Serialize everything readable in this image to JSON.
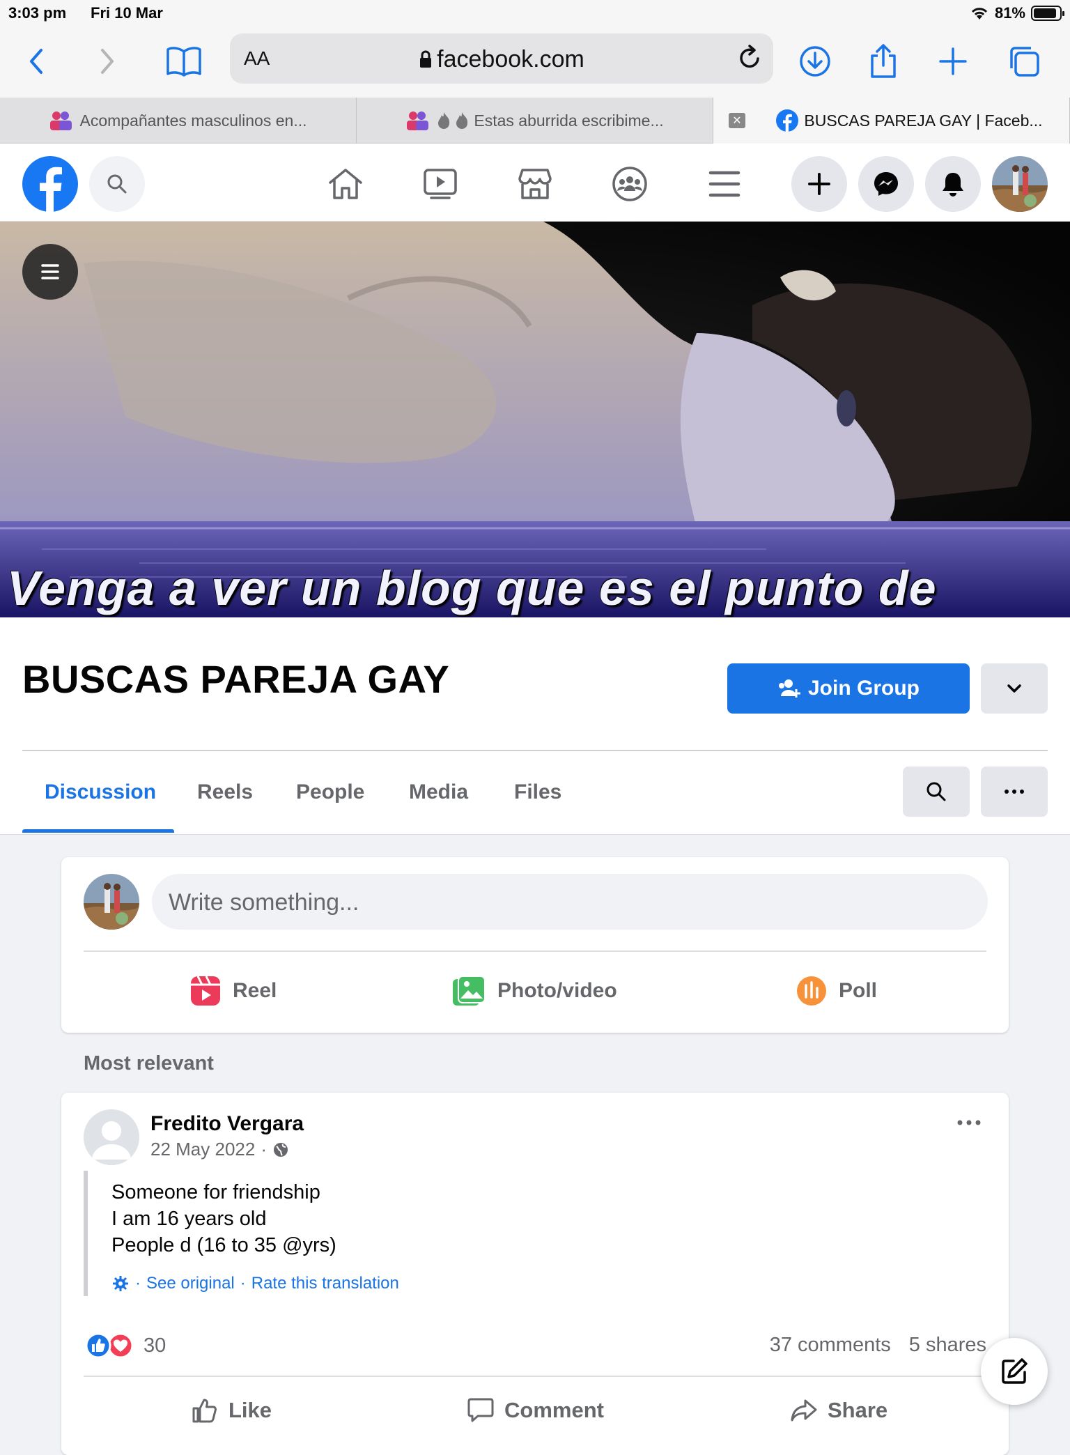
{
  "status_bar": {
    "time": "3:03 pm",
    "date": "Fri 10 Mar",
    "battery": "81%",
    "battery_level": 0.81
  },
  "browser": {
    "text_size_label": "AA",
    "url": "facebook.com",
    "tabs": [
      {
        "title": "Acompañantes masculinos en..."
      },
      {
        "title": "Estas aburrida escribime..."
      },
      {
        "title": "BUSCAS PAREJA GAY | Faceb..."
      }
    ]
  },
  "cover": {
    "caption": "Venga a ver un blog que es el punto de"
  },
  "group": {
    "title": "BUSCAS PAREJA GAY",
    "join_label": "Join Group",
    "tabs": [
      {
        "label": "Discussion"
      },
      {
        "label": "Reels"
      },
      {
        "label": "People"
      },
      {
        "label": "Media"
      },
      {
        "label": "Files"
      }
    ]
  },
  "composer": {
    "placeholder": "Write something...",
    "actions": {
      "reel": "Reel",
      "photo": "Photo/video",
      "poll": "Poll"
    }
  },
  "feed": {
    "sort_label": "Most relevant"
  },
  "post": {
    "author": "Fredito Vergara",
    "date": "22 May 2022",
    "meta_sep": "·",
    "body": [
      "Someone for friendship",
      "I am 16 years old",
      "People d (16 to 35 @yrs)"
    ],
    "translation": {
      "sep1": "·",
      "see_original": "See original",
      "sep2": "·",
      "rate": "Rate this translation"
    },
    "reaction_count": "30",
    "comments": "37 comments",
    "shares": "5 shares",
    "actions": {
      "like": "Like",
      "comment": "Comment",
      "share": "Share"
    }
  },
  "colors": {
    "accent": "#1b74e4",
    "background": "#f0f2f5",
    "secondary_text": "#65676b"
  }
}
